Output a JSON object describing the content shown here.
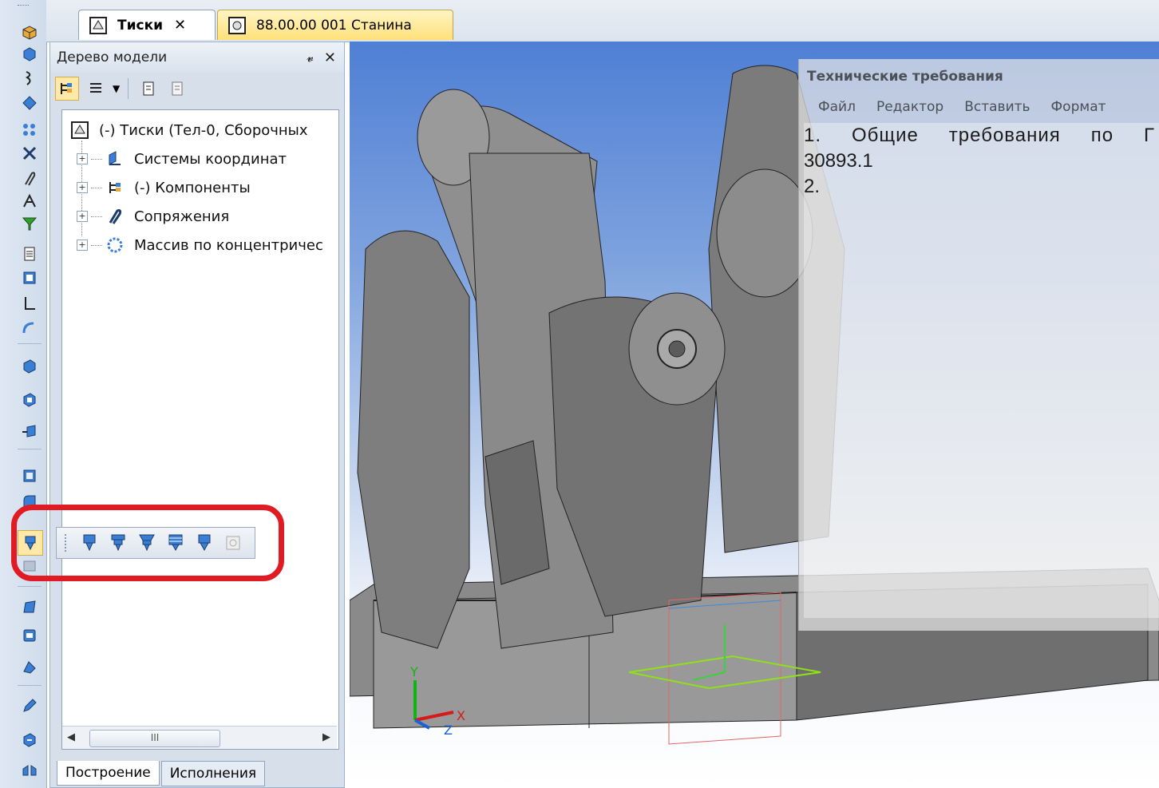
{
  "tabs": [
    {
      "label": "Тиски",
      "active": true,
      "close": "✕"
    },
    {
      "label": "88.00.00 001 Станина",
      "active": false
    }
  ],
  "tree_panel": {
    "title": "Дерево модели",
    "pin": "ᵖ",
    "close": "✕",
    "root": "(-) Тиски (Тел-0, Сборочных",
    "items": [
      {
        "label": "Системы координат",
        "icon": "coordinate-system-icon"
      },
      {
        "label": "(-) Компоненты",
        "icon": "components-icon"
      },
      {
        "label": "Сопряжения",
        "icon": "mates-icon"
      },
      {
        "label": "Массив по концентричес",
        "icon": "concentric-array-icon"
      }
    ],
    "scroll_thumb": "III",
    "bottom_tabs": [
      "Построение",
      "Исполнения"
    ]
  },
  "tech_panel": {
    "title": "Технические требования",
    "menu": [
      "Файл",
      "Редактор",
      "Вставить",
      "Формат"
    ],
    "line1_words": [
      "1.",
      "Общие",
      "требования",
      "по",
      "Г"
    ],
    "line2": "30893.1",
    "line3": "2."
  },
  "axes": {
    "x": "X",
    "y": "Y",
    "z": "Z"
  },
  "colors": {
    "accent_yellow": "#ffe17a",
    "highlight_red": "#e01b24",
    "viewport_top": "#4f7fd4"
  }
}
